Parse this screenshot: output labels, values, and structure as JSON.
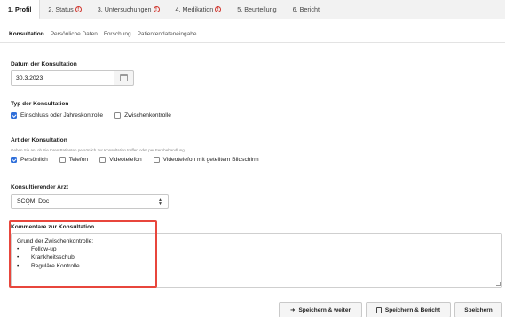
{
  "tabs": [
    {
      "label": "1. Profil",
      "warning": false
    },
    {
      "label": "2. Status",
      "warning": true
    },
    {
      "label": "3. Untersuchungen",
      "warning": true
    },
    {
      "label": "4. Medikation",
      "warning": true
    },
    {
      "label": "5. Beurteilung",
      "warning": false
    },
    {
      "label": "6. Bericht",
      "warning": false
    }
  ],
  "warning_glyph": "!",
  "subtabs": [
    "Konsultation",
    "Persönliche Daten",
    "Forschung",
    "Patientendateneingabe"
  ],
  "date": {
    "label": "Datum der Konsultation",
    "value": "30.3.2023"
  },
  "type": {
    "label": "Typ der Konsultation",
    "options": [
      {
        "label": "Einschluss oder Jahreskontrolle",
        "checked": true
      },
      {
        "label": "Zwischenkontrolle",
        "checked": false
      }
    ]
  },
  "mode": {
    "label": "Art der Konsultation",
    "hint": "Geben Sie an, ob Sie Ihren Patienten persönlich zur Konsultation treffen oder per Fernbehandlung.",
    "options": [
      {
        "label": "Persönlich",
        "checked": true
      },
      {
        "label": "Telefon",
        "checked": false
      },
      {
        "label": "Videotelefon",
        "checked": false
      },
      {
        "label": "Videotelefon mit geteiltem Bildschirm",
        "checked": false
      }
    ]
  },
  "doctor": {
    "label": "Konsultierender Arzt",
    "value": "SCQM, Doc"
  },
  "comments": {
    "label": "Kommentare zur Konsultation",
    "intro": "Grund der Zwischenkontrolle:",
    "items": [
      "Follow-up",
      "Krankheitsschub",
      "Reguläre Kontrolle"
    ]
  },
  "bullet_glyph": "•",
  "footer": {
    "save_next": "Speichern & weiter",
    "save_report": "Speichern & Bericht",
    "save": "Speichern"
  },
  "colors": {
    "accent": "#2f6fda",
    "highlight": "#e8463c",
    "warning": "#d0342c"
  }
}
